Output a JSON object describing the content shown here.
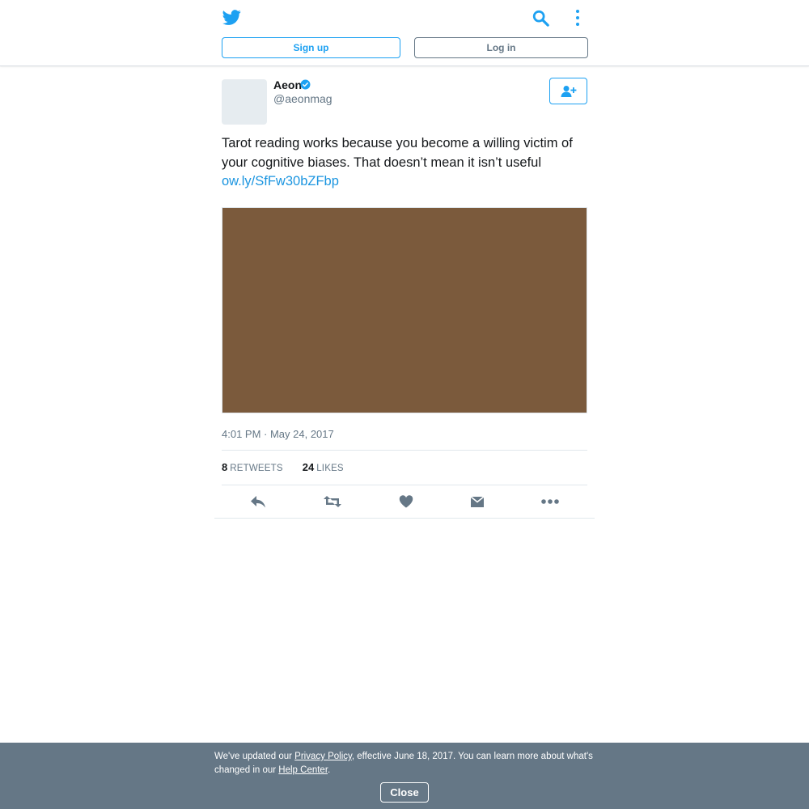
{
  "header": {
    "logo_icon": "twitter-bird-icon",
    "search_icon": "search-icon",
    "menu_icon": "more-vertical-icon",
    "signup_label": "Sign up",
    "login_label": "Log in"
  },
  "tweet": {
    "author_name": "Aeon",
    "verified_icon": "verified-badge-icon",
    "handle": "@aeonmag",
    "follow_icon": "follow-user-icon",
    "text": "Tarot reading works because you become a willing victim of your cognitive biases. That doesn’t mean it isn’t useful",
    "link": "ow.ly/SfFw30bZFbp",
    "timestamp": "4:01 PM · May 24, 2017",
    "retweets_count": "8",
    "retweets_label": "RETWEETS",
    "likes_count": "24",
    "likes_label": "LIKES",
    "actions": [
      "reply-icon",
      "retweet-icon",
      "like-icon",
      "direct-message-icon",
      "more-horizontal-icon"
    ]
  },
  "notice": {
    "text_before": "We've updated our ",
    "privacy_link": "Privacy Policy",
    "text_middle": ", effective June 18, 2017. You can learn more about what's changed in our ",
    "help_link": "Help Center",
    "text_after": ".",
    "close_label": "Close"
  },
  "colors": {
    "brand_blue": "#1da1f2",
    "link_blue": "#1b95e0",
    "gray": "#657786",
    "media_placeholder": "#7b5a3c"
  }
}
